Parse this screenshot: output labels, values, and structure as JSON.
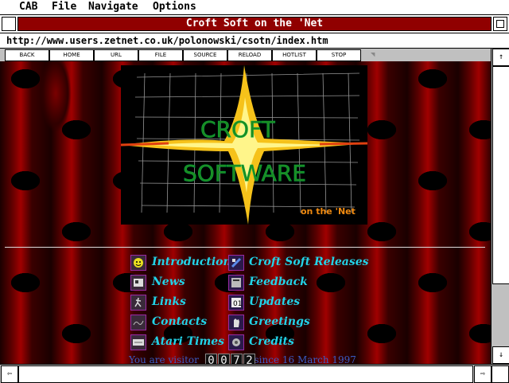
{
  "menu": [
    "CAB",
    "File",
    "Navigate",
    "Options"
  ],
  "window_title": "Croft Soft on the 'Net",
  "url": "http://www.users.zetnet.co.uk/polonowski/csotn/index.htm",
  "toolbar": [
    "BACK",
    "HOME",
    "URL",
    "FILE",
    "SOURCE",
    "RELOAD",
    "HOTLIST",
    "STOP"
  ],
  "logo": {
    "line1": "CROFT",
    "line2": "SOFTWARE",
    "tagline": "on the 'Net"
  },
  "links_left": [
    "Introduction",
    "News",
    "Links",
    "Contacts",
    "Atari Times"
  ],
  "links_right": [
    "Croft Soft Releases",
    "Feedback",
    "Updates",
    "Greetings",
    "Credits"
  ],
  "visitor": {
    "prefix": "You are visitor",
    "digits": [
      "0",
      "0",
      "7",
      "2"
    ],
    "suffix": "since 16 March 1997"
  },
  "scroll_arrows": {
    "up": "↑",
    "down": "↓",
    "left": "⇦",
    "right": "⇨"
  }
}
